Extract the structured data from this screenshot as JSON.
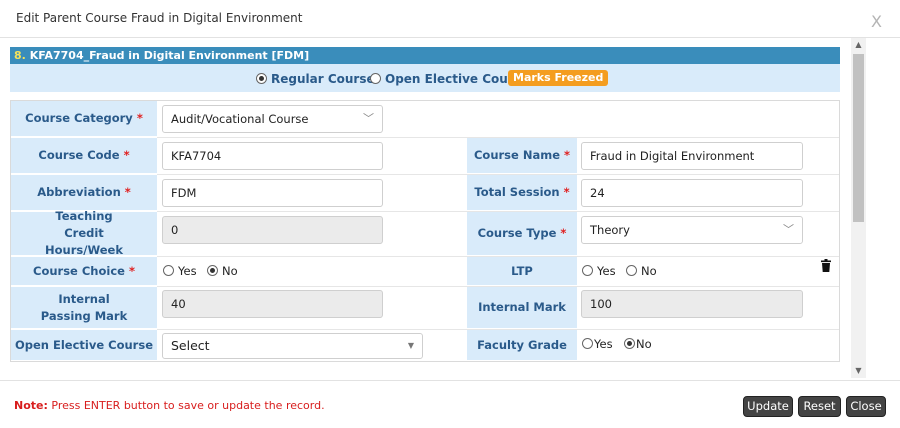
{
  "modal": {
    "title": "Edit Parent Course Fraud in Digital Environment",
    "close_glyph": "X"
  },
  "course_header": {
    "number": "8.",
    "text": "KFA7704_Fraud in Digital Environment [FDM]"
  },
  "mode": {
    "regular_label": "Regular Course",
    "open_elective_label": "Open Elective Course",
    "selected": "Regular Course",
    "badge": "Marks Freezed"
  },
  "form": {
    "course_category": {
      "label": "Course Category",
      "value": "Audit/Vocational Course"
    },
    "course_code": {
      "label": "Course Code",
      "value": "KFA7704"
    },
    "course_name": {
      "label": "Course Name",
      "value": "Fraud in Digital Environment"
    },
    "abbreviation": {
      "label": "Abbreviation",
      "value": "FDM"
    },
    "total_session": {
      "label": "Total Session",
      "value": "24"
    },
    "teaching_credit": {
      "label": "Teaching Credit Hours/Week",
      "value": "0"
    },
    "course_type": {
      "label": "Course Type",
      "value": "Theory"
    },
    "course_choice": {
      "label": "Course Choice",
      "yes": "Yes",
      "no": "No",
      "selected": "No"
    },
    "ltp": {
      "label": "LTP",
      "yes": "Yes",
      "no": "No"
    },
    "internal_passing": {
      "label": "Internal Passing Mark",
      "value": "40"
    },
    "internal_mark": {
      "label": "Internal Mark",
      "value": "100"
    },
    "open_elective_course": {
      "label": "Open Elective Course",
      "value": "Select"
    },
    "faculty_grade": {
      "label": "Faculty Grade",
      "yes": "Yes",
      "no": "No",
      "selected": "No"
    },
    "required_mark": "*"
  },
  "footer": {
    "note_prefix": "Note:",
    "note_text": " Press ENTER button to save or update the record.",
    "update": "Update",
    "reset": "Reset",
    "close": "Close"
  },
  "icons": {
    "trash": "trash-icon",
    "chevron": "chevron-down-icon",
    "scroll_up": "scroll-up-icon",
    "scroll_down": "scroll-down-icon"
  },
  "colors": {
    "header_bar": "#3a8dbb",
    "label_bg": "#d9ebfa",
    "badge": "#f49d1f",
    "note": "#d81d1d",
    "button": "#444444"
  }
}
